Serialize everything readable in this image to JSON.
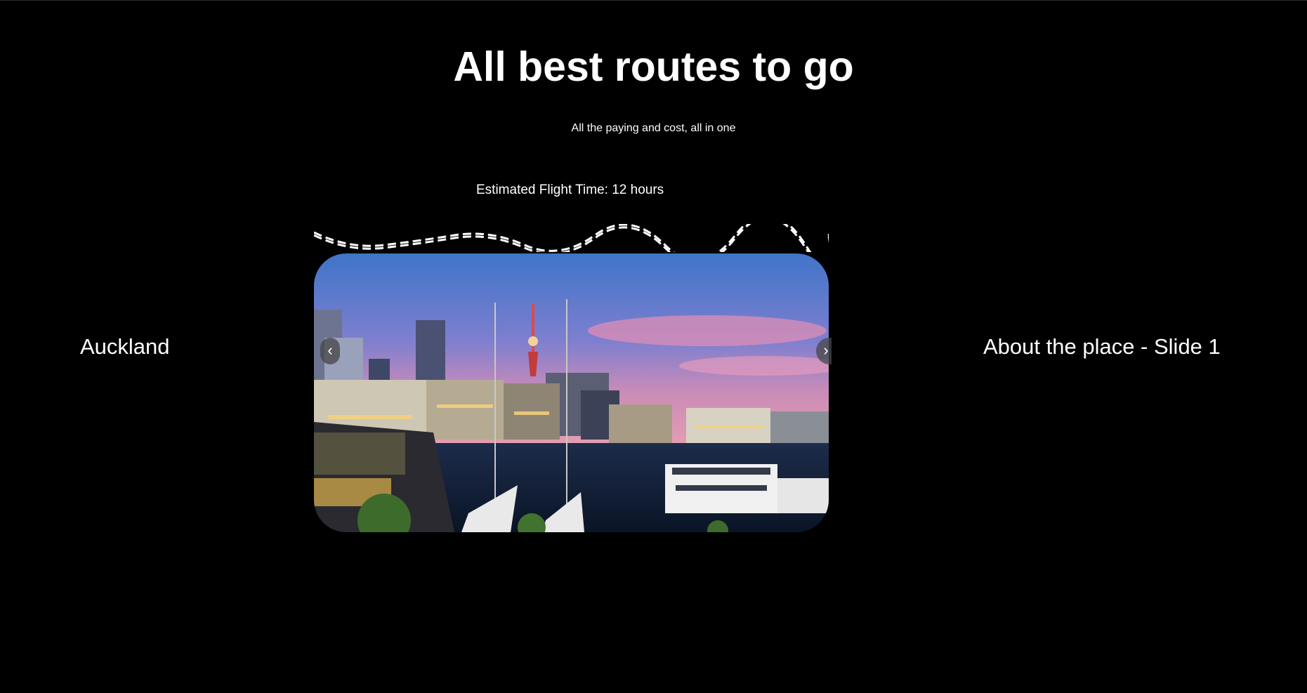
{
  "header": {
    "title": "All best routes to go",
    "subtitle": "All the paying and cost, all in one"
  },
  "route": {
    "flight_time": "Estimated Flight Time: 12 hours"
  },
  "destination": {
    "city": "Auckland",
    "about": "About the place - Slide 1"
  },
  "carousel": {
    "prev_label": "‹",
    "next_label": "›",
    "image_alt": "Auckland"
  },
  "colors": {
    "background": "#000000",
    "text": "#ffffff",
    "button": "#464646"
  }
}
